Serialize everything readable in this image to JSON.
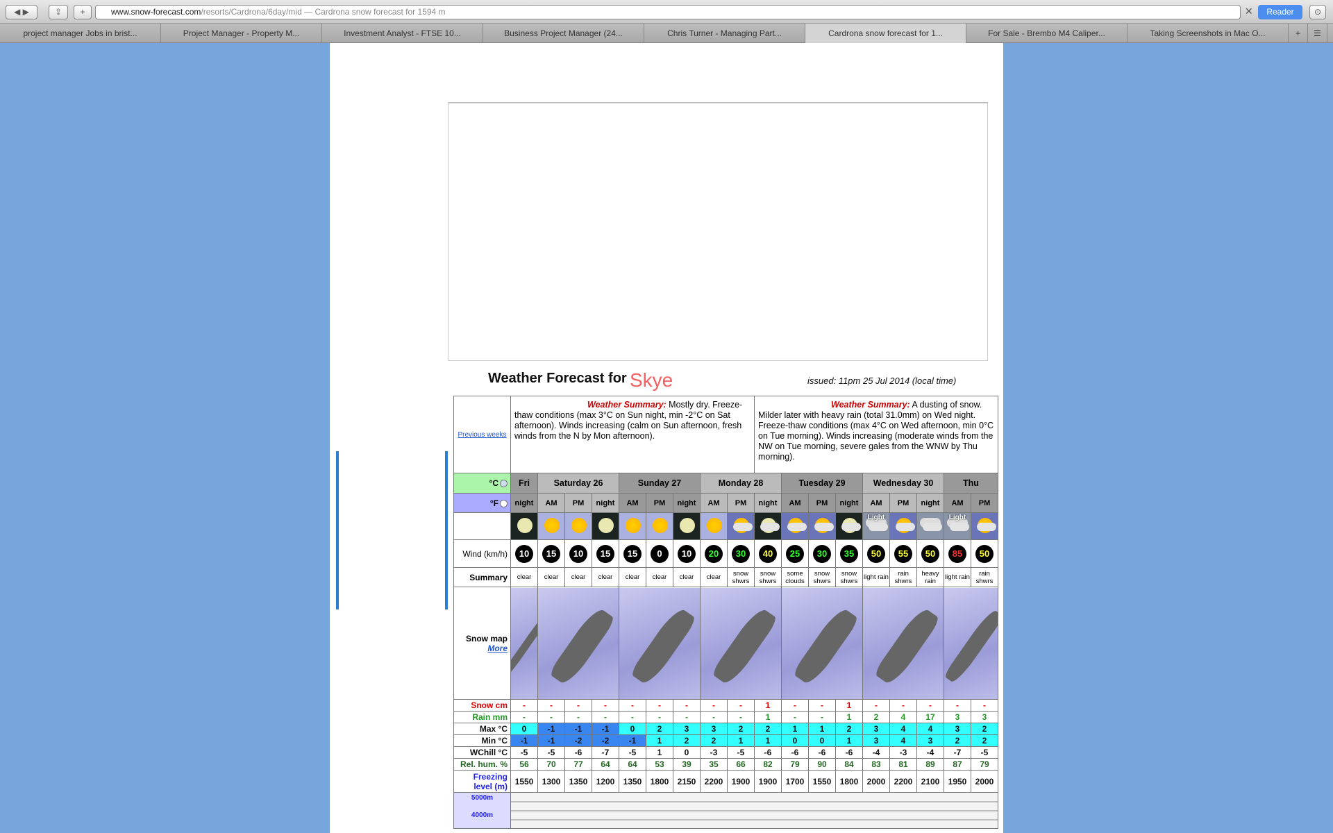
{
  "browser": {
    "url_domain": "www.snow-forecast.com",
    "url_path": "/resorts/Cardrona/6day/mid",
    "page_title": " — Cardrona snow forecast for 1594 m",
    "reader": "Reader",
    "tabs": [
      "project manager Jobs in brist...",
      "Project Manager - Property M...",
      "Investment Analyst - FTSE 10...",
      "Business Project Manager (24...",
      "Chris Turner - Managing Part...",
      "Cardrona snow forecast for 1...",
      "For Sale - Brembo M4 Caliper...",
      "Taking Screenshots in Mac O..."
    ],
    "active_tab": 5
  },
  "header": {
    "title": "Weather Forecast for",
    "location": "Skye",
    "issued": "issued: 11pm 25 Jul 2014 (local time)"
  },
  "summary": {
    "previous": "Previous weeks",
    "heading": "Weather Summary:",
    "left": "Mostly dry. Freeze-thaw conditions (max 3°C on Sun night, min -2°C on Sat afternoon). Winds increasing (calm on Sun afternoon, fresh winds from the N by Mon afternoon).",
    "right": "A dusting of snow. Milder later with heavy rain (total 31.0mm) on Wed night. Freeze-thaw conditions (max 4°C on Wed afternoon, min 0°C on Tue morning). Winds increasing (moderate winds from the NW on Tue morning, severe gales from the WNW by Thu morning)."
  },
  "units": {
    "celsius": "°C",
    "fahrenheit": "°F",
    "selected": "celsius"
  },
  "days": [
    {
      "name": "Fri",
      "span": 1
    },
    {
      "name": "Saturday 26",
      "span": 3
    },
    {
      "name": "Sunday 27",
      "span": 3
    },
    {
      "name": "Monday 28",
      "span": 3
    },
    {
      "name": "Tuesday 29",
      "span": 3
    },
    {
      "name": "Wednesday 30",
      "span": 3
    },
    {
      "name": "Thu",
      "span": 2
    }
  ],
  "times": [
    "night",
    "AM",
    "PM",
    "night",
    "AM",
    "PM",
    "night",
    "AM",
    "PM",
    "night",
    "AM",
    "PM",
    "night",
    "AM",
    "PM",
    "night",
    "AM",
    "PM"
  ],
  "icons": [
    "clear-night",
    "sun",
    "sun",
    "clear-night",
    "sun",
    "sun",
    "clear-night",
    "sun",
    "snow-showers",
    "snow-showers-night",
    "some-clouds",
    "snow-showers",
    "snow-showers-night",
    "light-rain",
    "rain-showers",
    "heavy-rain",
    "light-rain",
    "rain-showers"
  ],
  "icon_text": [
    "",
    "",
    "",
    "",
    "",
    "",
    "",
    "",
    "",
    "",
    "",
    "",
    "",
    "Light",
    "",
    "",
    "Light",
    ""
  ],
  "labels": {
    "wind": "Wind (km/h)",
    "summary": "Summary",
    "snowmap": "Snow map",
    "more": "More",
    "snow": "Snow cm",
    "rain": "Rain mm",
    "max": "Max °C",
    "min": "Min °C",
    "wchill": "WChill °C",
    "hum": "Rel. hum. %",
    "freezing": "Freezing level (m)",
    "alt1": "5000m",
    "alt2": "4000m"
  },
  "wind": [
    10,
    15,
    10,
    15,
    15,
    0,
    10,
    20,
    30,
    40,
    25,
    30,
    35,
    50,
    55,
    50,
    85,
    50
  ],
  "wind_colors": {
    "white": "#ffffff",
    "green": "#33ff33",
    "yellow": "#ffff33",
    "red": "#ff3333"
  },
  "summaries": [
    "clear",
    "clear",
    "clear",
    "clear",
    "clear",
    "clear",
    "clear",
    "clear",
    "snow shwrs",
    "snow shwrs",
    "some clouds",
    "snow shwrs",
    "snow shwrs",
    "light rain",
    "rain shwrs",
    "heavy rain",
    "light rain",
    "rain shwrs"
  ],
  "snow": [
    "-",
    "-",
    "-",
    "-",
    "-",
    "-",
    "-",
    "-",
    "-",
    "1",
    "-",
    "-",
    "1",
    "-",
    "-",
    "-",
    "-",
    "-"
  ],
  "rain": [
    "-",
    "-",
    "-",
    "-",
    "-",
    "-",
    "-",
    "-",
    "-",
    "1",
    "-",
    "-",
    "1",
    "2",
    "4",
    "17",
    "3",
    "3"
  ],
  "max": [
    0,
    -1,
    -1,
    -1,
    0,
    2,
    3,
    3,
    2,
    2,
    1,
    1,
    2,
    3,
    4,
    4,
    3,
    2
  ],
  "min": [
    -1,
    -1,
    -2,
    -2,
    -1,
    1,
    2,
    2,
    1,
    1,
    0,
    0,
    1,
    3,
    4,
    3,
    2,
    2
  ],
  "wchill": [
    -5,
    -5,
    -6,
    -7,
    -5,
    1,
    0,
    -3,
    -5,
    -6,
    -6,
    -6,
    -6,
    -4,
    -3,
    -4,
    -7,
    -5
  ],
  "hum": [
    56,
    70,
    77,
    64,
    64,
    53,
    39,
    35,
    66,
    82,
    79,
    90,
    84,
    83,
    81,
    89,
    87,
    79
  ],
  "freezing": [
    1550,
    1300,
    1350,
    1200,
    1350,
    1800,
    2150,
    2200,
    1900,
    1900,
    1700,
    1550,
    1800,
    2000,
    2200,
    2100,
    1950,
    2000
  ],
  "colors": {
    "cold": "#3a86f0",
    "warm": "#33ffff",
    "snow": "#dd0000",
    "rain": "#229922",
    "hum": "#226622",
    "freezing": "#2222ee",
    "celsius_bg": "#aaf5aa",
    "fahrenheit_bg": "#aaaaff"
  }
}
